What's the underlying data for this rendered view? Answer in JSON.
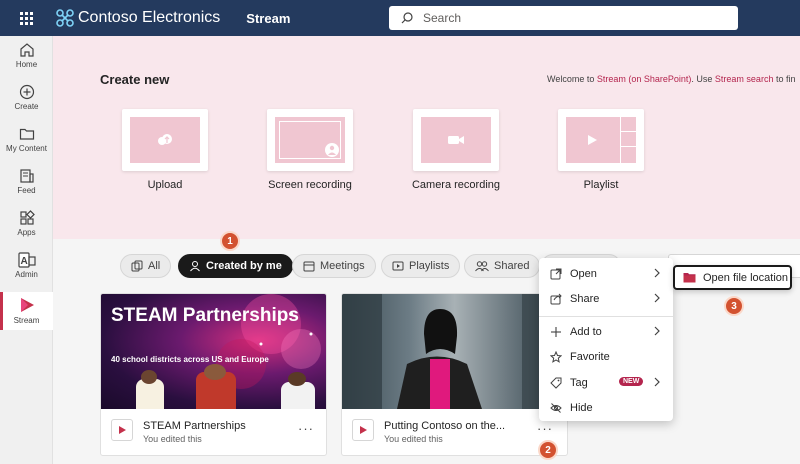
{
  "topbar": {
    "brand": "Contoso Electronics",
    "app": "Stream",
    "search_placeholder": "Search"
  },
  "rail": {
    "items": [
      {
        "label": "Home",
        "icon": "home-icon"
      },
      {
        "label": "Create",
        "icon": "plus-circle-icon"
      },
      {
        "label": "My Content",
        "icon": "folder-icon"
      },
      {
        "label": "Feed",
        "icon": "feed-icon"
      },
      {
        "label": "Apps",
        "icon": "apps-icon"
      },
      {
        "label": "Admin",
        "icon": "admin-icon"
      },
      {
        "label": "Stream",
        "icon": "stream-icon",
        "active": true
      }
    ]
  },
  "hero": {
    "title": "Create new",
    "welcome_prefix": "Welcome to ",
    "welcome_link1": "Stream (on SharePoint)",
    "welcome_mid": ". Use ",
    "welcome_link2": "Stream search",
    "welcome_suffix": " to fin",
    "cards": [
      {
        "label": "Upload"
      },
      {
        "label": "Screen recording"
      },
      {
        "label": "Camera recording"
      },
      {
        "label": "Playlist"
      }
    ]
  },
  "filters": {
    "all": "All",
    "created": "Created by me",
    "meetings": "Meetings",
    "playlists": "Playlists",
    "shared": "Shared"
  },
  "callouts": [
    "1",
    "2",
    "3"
  ],
  "videos": [
    {
      "title": "STEAM Partnerships",
      "sub": "You edited this",
      "thumb_title": "STEAM Partnerships",
      "thumb_sub": "40 school districts across US and Europe"
    },
    {
      "title": "Putting Contoso on the...",
      "sub": "You edited this"
    }
  ],
  "menu": {
    "open": "Open",
    "share": "Share",
    "add_to": "Add to",
    "favorite": "Favorite",
    "tag": "Tag",
    "new_badge": "NEW",
    "hide": "Hide"
  },
  "submenu": {
    "open_file_location": "Open file location"
  },
  "colors": {
    "topbar": "#243a5e",
    "accent": "#c4314b",
    "hero": "#f9e7ec",
    "callout": "#d35230"
  }
}
